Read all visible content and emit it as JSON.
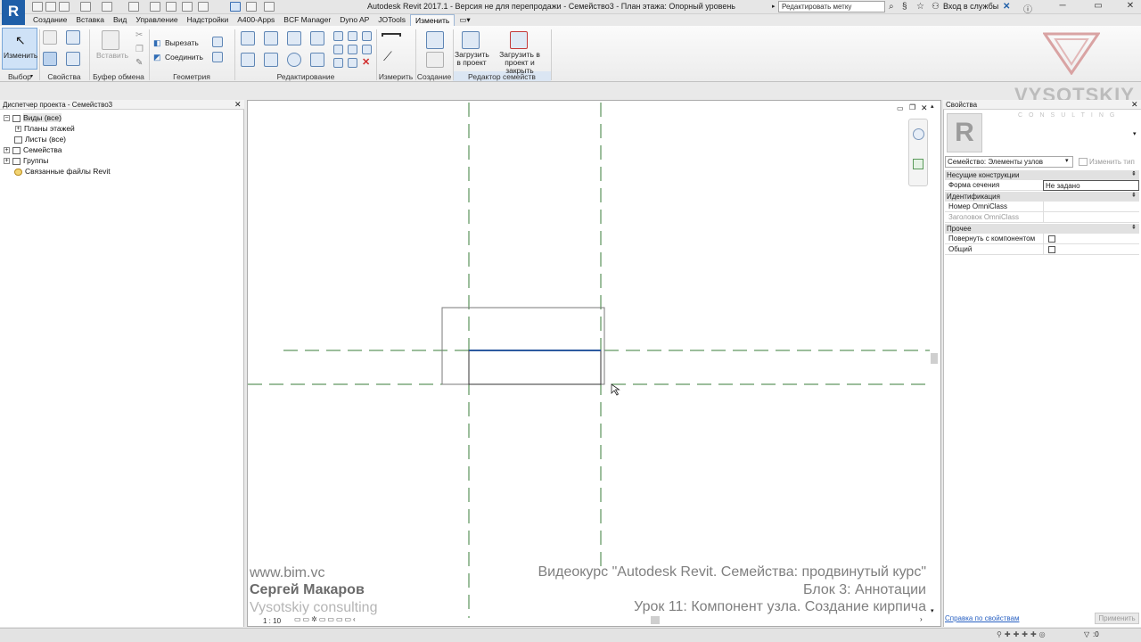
{
  "window": {
    "title": "Autodesk Revit 2017.1 - Версия не для перепродажи -    Семейство3 - План этажа: Опорный уровень",
    "search_value": "Редактировать метку",
    "signin_label": "Вход в службы"
  },
  "app_logo": "R",
  "tabs": [
    "Создание",
    "Вставка",
    "Вид",
    "Управление",
    "Надстройки",
    "A400-Apps",
    "BCF Manager",
    "Dyno AP",
    "JOTools",
    "Изменить"
  ],
  "active_tab": "Изменить",
  "ribbon": {
    "modify_label": "Изменить",
    "paste_label": "Вставить",
    "cut_label": "Вырезать",
    "join_label": "Соединить",
    "load_into_project_label": "Загрузить в проект",
    "load_and_close_label": "Загрузить в проект и закрыть",
    "panels": {
      "select": "Выбор",
      "properties": "Свойства",
      "clipboard": "Буфер обмена",
      "geometry": "Геометрия",
      "modify": "Редактирование",
      "measure": "Измерить",
      "create": "Создание",
      "family_editor": "Редактор семейств"
    }
  },
  "project_browser": {
    "title": "Диспетчер проекта - Семейство3",
    "items": {
      "views": "Виды (все)",
      "floor_plans": "Планы этажей",
      "sheets": "Листы (все)",
      "families": "Семейства",
      "groups": "Группы",
      "revit_links": "Связанные файлы Revit"
    }
  },
  "canvas": {
    "scale": "1 : 10",
    "credits": {
      "site": "www.bim.vc",
      "author": "Сергей Макаров",
      "company": "Vysotskiy consulting",
      "course": "Видеокурс \"Autodesk Revit. Семейства: продвинутый курс\"",
      "block": "Блок 3: Аннотации",
      "lesson": "Урок 11: Компонент узла. Создание кирпича"
    }
  },
  "properties": {
    "title": "Свойства",
    "type_preview_letter": "R",
    "type_selector": "Семейство: Элементы узлов",
    "edit_type_label": "Изменить тип",
    "groups": {
      "structural": "Несущие конструкции",
      "identity": "Идентификация",
      "other": "Прочее"
    },
    "rows": {
      "section_shape_name": "Форма сечения",
      "section_shape_value": "Не задано",
      "omniclass_number": "Номер OmniClass",
      "omniclass_title": "Заголовок OmniClass",
      "rotate_with_component": "Повернуть с компонентом",
      "shared": "Общий"
    },
    "help_link": "Справка по свойствам",
    "apply_label": "Применить"
  },
  "watermark": {
    "name": "VYSOTSKIY",
    "sub": "CONSULTING"
  },
  "status_bar": {
    "filter_count": ":0"
  },
  "colors": {
    "ref_plane": "#3a7d3a",
    "selected_edge": "#2d5aa0",
    "accent": "#1f5fa8"
  }
}
